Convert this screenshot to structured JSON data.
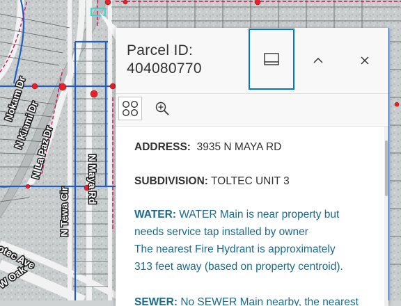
{
  "map": {
    "streets": [
      "Nokam Dr",
      "N Kiami Dr",
      "N La Paz Dr",
      "N Tewa Cir",
      "N Maya Rd",
      "otec Ave",
      "W Oak"
    ]
  },
  "popup": {
    "title_line1": "Parcel ID:",
    "title_line2": "404080770",
    "buttons": {
      "dock": "dock-icon",
      "collapse": "chevron-up-icon",
      "close": "close-icon"
    },
    "tools": {
      "select": "four-circles-icon",
      "zoom": "zoom-in-icon"
    },
    "address_label": "ADDRESS:",
    "address_value": "3935 N MAYA RD",
    "subdivision_label": "SUBDIVISION:",
    "subdivision_value": "TOLTEC UNIT 3",
    "water_label": "WATER:",
    "water_line1": "WATER Main is near property but",
    "water_line2": "needs service tap installed by owner",
    "water_line3": "The nearest Fire Hydrant is approximately",
    "water_line4": "313 feet away (based on property centroid).",
    "sewer_label": "SEWER:",
    "sewer_text": "No SEWER Main nearby, the nearest"
  },
  "colors": {
    "accent": "#0079c1",
    "info_text": "#1a6a8c",
    "water_main": "#1f5fc2",
    "sewer_main": "#c2185b",
    "hydrant": "#e8202a"
  }
}
